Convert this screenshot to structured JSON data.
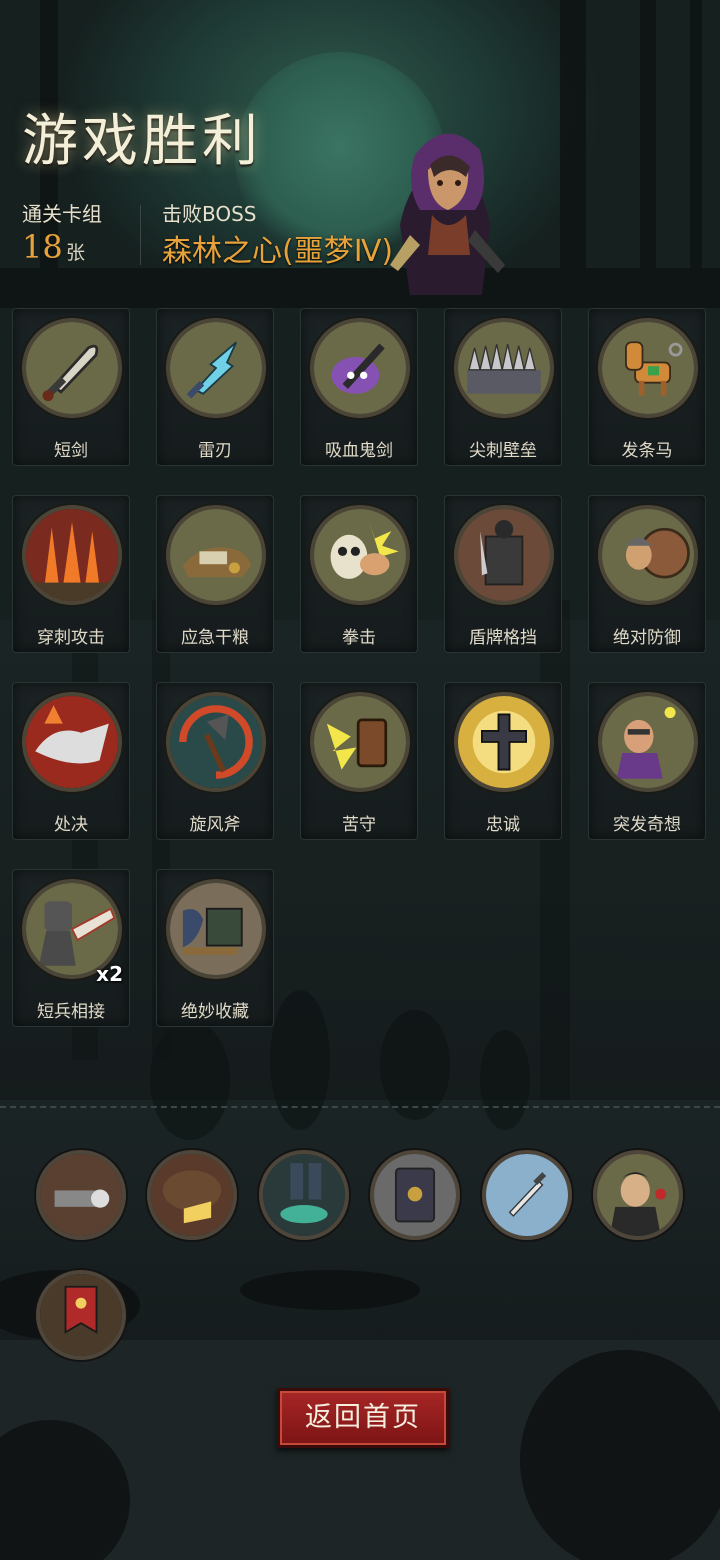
{
  "header": {
    "title": "游戏胜利",
    "deck_label": "通关卡组",
    "deck_count": "18",
    "deck_unit": "张",
    "boss_label": "击败BOSS",
    "boss_name": "森林之心(噩梦Ⅳ)"
  },
  "cards": [
    {
      "name": "短剑",
      "icon": "short-sword-icon"
    },
    {
      "name": "雷刃",
      "icon": "thunder-blade-icon"
    },
    {
      "name": "吸血鬼剑",
      "icon": "vampire-sword-icon"
    },
    {
      "name": "尖刺壁垒",
      "icon": "spike-wall-icon"
    },
    {
      "name": "发条马",
      "icon": "clockwork-horse-icon"
    },
    {
      "name": "穿刺攻击",
      "icon": "pierce-attack-icon"
    },
    {
      "name": "应急干粮",
      "icon": "emergency-ration-icon"
    },
    {
      "name": "拳击",
      "icon": "punch-icon"
    },
    {
      "name": "盾牌格挡",
      "icon": "shield-block-icon"
    },
    {
      "name": "绝对防御",
      "icon": "absolute-defense-icon"
    },
    {
      "name": "处决",
      "icon": "execution-icon"
    },
    {
      "name": "旋风斧",
      "icon": "whirlwind-axe-icon"
    },
    {
      "name": "苦守",
      "icon": "hold-fast-icon"
    },
    {
      "name": "忠诚",
      "icon": "loyalty-cross-icon"
    },
    {
      "name": "突发奇想",
      "icon": "sudden-idea-icon"
    },
    {
      "name": "短兵相接",
      "icon": "close-combat-icon",
      "count": "x2"
    },
    {
      "name": "绝妙收藏",
      "icon": "collection-icon"
    }
  ],
  "relics": [
    {
      "icon": "cannon-relic-icon"
    },
    {
      "icon": "cheese-relic-icon"
    },
    {
      "icon": "green-flame-relic-icon"
    },
    {
      "icon": "spellbook-relic-icon"
    },
    {
      "icon": "dagger-relic-icon"
    },
    {
      "icon": "vampire-relic-icon"
    },
    {
      "icon": "banner-relic-icon"
    }
  ],
  "footer": {
    "back_label": "返回首页"
  },
  "colors": {
    "accent": "#e8a23a",
    "button": "#a82626",
    "card_bg": "#1b2223"
  }
}
